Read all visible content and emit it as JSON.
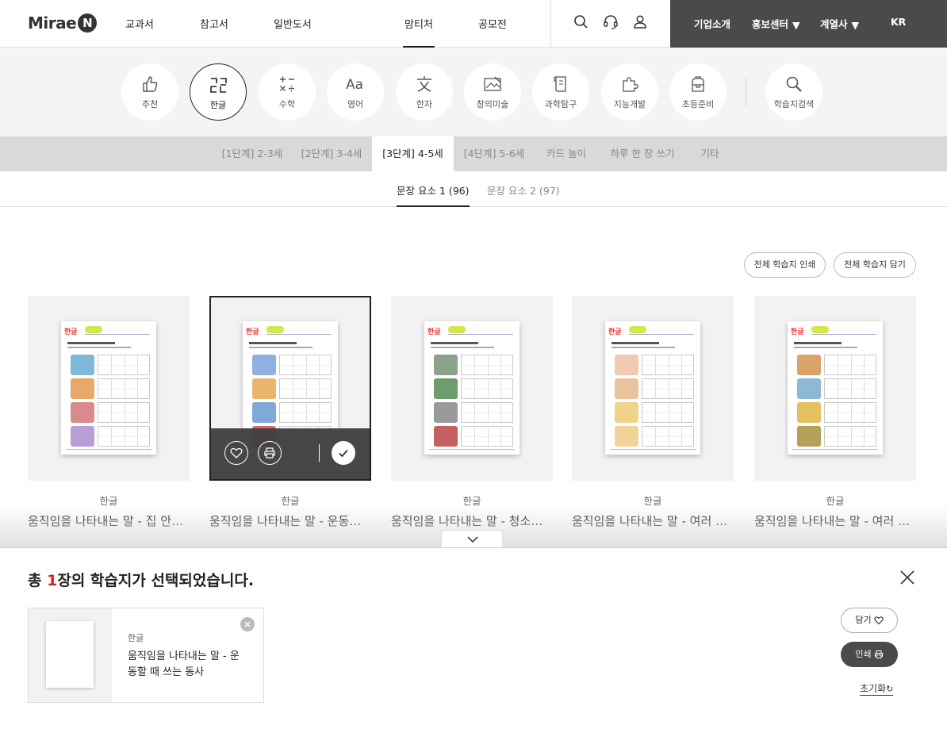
{
  "header": {
    "logo_text": "Mirae",
    "logo_badge": "N",
    "nav": [
      {
        "label": "교과서"
      },
      {
        "label": "참고서"
      },
      {
        "label": "일반도서"
      },
      {
        "label": "맘티처",
        "active": true
      },
      {
        "label": "공모전"
      }
    ],
    "icons": [
      "search-icon",
      "headset-icon",
      "user-icon"
    ],
    "corp_links": [
      "기업소개",
      "홍보센터",
      "계열사"
    ],
    "lang": "KR"
  },
  "categories": [
    {
      "label": "추천",
      "icon": "thumbs-up-icon"
    },
    {
      "label": "한글",
      "icon": "hangul-icon",
      "active": true
    },
    {
      "label": "수학",
      "icon": "math-icon"
    },
    {
      "label": "영어",
      "icon": "english-icon"
    },
    {
      "label": "한자",
      "icon": "hanja-icon"
    },
    {
      "label": "창의미술",
      "icon": "art-icon"
    },
    {
      "label": "과학탐구",
      "icon": "science-icon"
    },
    {
      "label": "지능개발",
      "icon": "puzzle-icon"
    },
    {
      "label": "초등준비",
      "icon": "backpack-icon"
    },
    {
      "label": "학습지검색",
      "icon": "search-icon"
    }
  ],
  "levels": [
    {
      "label": "[1단계] 2-3세"
    },
    {
      "label": "[2단계] 3-4세"
    },
    {
      "label": "[3단계] 4-5세",
      "active": true
    },
    {
      "label": "[4단계] 5-6세"
    },
    {
      "label": "카드 놀이"
    },
    {
      "label": "하루 한 장 쓰기"
    },
    {
      "label": "기타"
    }
  ],
  "subtabs": [
    {
      "label": "문장 요소 1 (96)",
      "active": true
    },
    {
      "label": "문장 요소 2 (97)"
    }
  ],
  "actions": {
    "print_all": "전체 학습지 인쇄",
    "save_all": "전체 학습지 담기"
  },
  "cards": [
    {
      "category": "한글",
      "title": "움직임을 나타내는 말 - 집 안에서 하는 동사",
      "sheet_tag": "한글"
    },
    {
      "category": "한글",
      "title": "움직임을 나타내는 말 - 운동할 때 쓰는 동사",
      "sheet_tag": "한글",
      "selected": true
    },
    {
      "category": "한글",
      "title": "움직임을 나타내는 말 - 청소할 때 쓰는 동사",
      "sheet_tag": "한글"
    },
    {
      "category": "한글",
      "title": "움직임을 나타내는 말 - 여러 가지 동사",
      "sheet_tag": "한글"
    },
    {
      "category": "한글",
      "title": "움직임을 나타내는 말 - 여러 가지 동사",
      "sheet_tag": "한글"
    }
  ],
  "selection": {
    "msg_prefix": "총 ",
    "count": "1",
    "msg_suffix": "장의 학습지가 선택되었습니다.",
    "item": {
      "category": "한글",
      "title": "움직임을 나타내는 말 - 운동할 때 쓰는 동사"
    },
    "save_label": "담기",
    "print_label": "인쇄",
    "reset_label": "초기화"
  },
  "colors": {
    "accent_red": "#e21b1b",
    "dark_bar": "#4a4a4a"
  }
}
